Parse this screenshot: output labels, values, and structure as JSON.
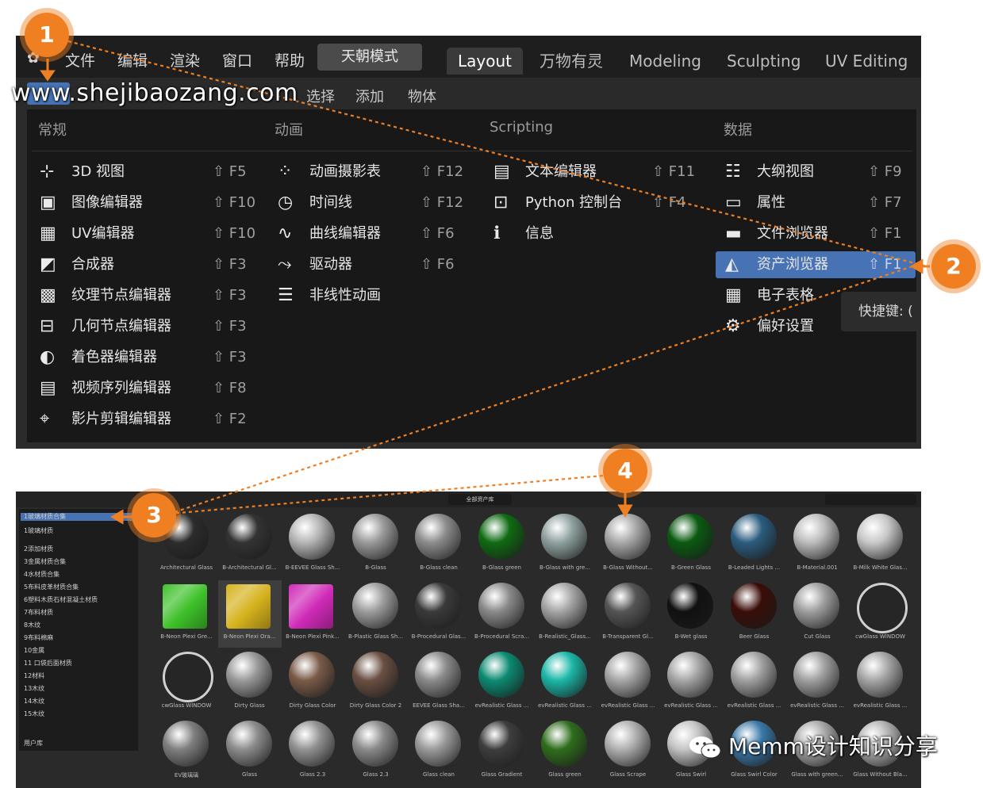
{
  "topbar": {
    "menu": [
      "文件",
      "编辑",
      "渲染",
      "窗口",
      "帮助"
    ],
    "mode_button": "天朝模式",
    "workspace_tabs": [
      "Layout",
      "万物有灵",
      "Modeling",
      "Sculpting",
      "UV Editing"
    ]
  },
  "subheader": {
    "items": [
      "选择",
      "添加",
      "物体"
    ]
  },
  "editor_menu": {
    "columns": [
      "常规",
      "动画",
      "Scripting",
      "数据"
    ],
    "general": [
      {
        "label": "3D 视图",
        "key": "⇧ F5",
        "icon": "3d-view-icon"
      },
      {
        "label": "图像编辑器",
        "key": "⇧ F10",
        "icon": "image-editor-icon"
      },
      {
        "label": "UV编辑器",
        "key": "⇧ F10",
        "icon": "uv-editor-icon"
      },
      {
        "label": "合成器",
        "key": "⇧ F3",
        "icon": "compositor-icon"
      },
      {
        "label": "纹理节点编辑器",
        "key": "⇧ F3",
        "icon": "texture-node-icon"
      },
      {
        "label": "几何节点编辑器",
        "key": "⇧ F3",
        "icon": "geometry-node-icon"
      },
      {
        "label": "着色器编辑器",
        "key": "⇧ F3",
        "icon": "shader-editor-icon"
      },
      {
        "label": "视频序列编辑器",
        "key": "⇧ F8",
        "icon": "video-sequencer-icon"
      },
      {
        "label": "影片剪辑编辑器",
        "key": "⇧ F2",
        "icon": "movie-clip-icon"
      }
    ],
    "animation": [
      {
        "label": "动画摄影表",
        "key": "⇧ F12",
        "icon": "dopesheet-icon"
      },
      {
        "label": "时间线",
        "key": "⇧ F12",
        "icon": "timeline-icon"
      },
      {
        "label": "曲线编辑器",
        "key": "⇧ F6",
        "icon": "graph-editor-icon"
      },
      {
        "label": "驱动器",
        "key": "⇧ F6",
        "icon": "drivers-icon"
      },
      {
        "label": "非线性动画",
        "key": "",
        "icon": "nla-icon"
      }
    ],
    "scripting": [
      {
        "label": "文本编辑器",
        "key": "⇧ F11",
        "icon": "text-editor-icon"
      },
      {
        "label": "Python 控制台",
        "key": "⇧ F4",
        "icon": "python-console-icon"
      },
      {
        "label": "信息",
        "key": "",
        "icon": "info-icon"
      }
    ],
    "data": [
      {
        "label": "大纲视图",
        "key": "⇧ F9",
        "icon": "outliner-icon"
      },
      {
        "label": "属性",
        "key": "⇧ F7",
        "icon": "properties-icon"
      },
      {
        "label": "文件浏览器",
        "key": "⇧ F1",
        "icon": "file-browser-icon"
      },
      {
        "label": "资产浏览器",
        "key": "⇧ F1",
        "icon": "asset-browser-icon"
      },
      {
        "label": "电子表格",
        "key": "",
        "icon": "spreadsheet-icon"
      },
      {
        "label": "偏好设置",
        "key": "",
        "icon": "preferences-icon"
      }
    ],
    "tooltip": "快捷键: ("
  },
  "watermark_top": "www.shejibaozang.com",
  "badges": [
    "1",
    "2",
    "3",
    "4"
  ],
  "asset_browser": {
    "side_items": [
      "1玻璃材质合集",
      "1玻璃材质",
      "2添加材质",
      "3金属材质合集",
      "4水材质合集",
      "5布料皮革材质合集",
      "6塑料木质石材混凝土材质",
      "7布料材质",
      "8木纹",
      "9布料棉麻",
      "10金属",
      "11 口袋后面材质",
      "12材料",
      "13木纹",
      "14木纹",
      "15木纹",
      "用户库"
    ],
    "filter": "全部资产库",
    "items": [
      {
        "name": "Architectural Glass",
        "color": "#2c2c2c"
      },
      {
        "name": "B-Architectural Gl...",
        "color": "#333333"
      },
      {
        "name": "B-EEVEE Glass Sh...",
        "color": "#b5b5b5"
      },
      {
        "name": "B-Glass",
        "color": "#9a9a9a"
      },
      {
        "name": "B-Glass clean",
        "color": "#8c8c8c"
      },
      {
        "name": "B-Glass green",
        "color": "#0f6b12"
      },
      {
        "name": "B-Glass with gre...",
        "color": "#8fa2a0"
      },
      {
        "name": "B-Glass Without...",
        "color": "#a8a8a8"
      },
      {
        "name": "B-Green Glass",
        "color": "#0a5a10"
      },
      {
        "name": "B-Leaded Lights ...",
        "color": "#2b5c7e"
      },
      {
        "name": "B-Material.001",
        "color": "#bcbcbc"
      },
      {
        "name": "B-Milk White Glas...",
        "color": "#c8c8c8"
      },
      {
        "name": "B-Neon Plexi Gre...",
        "color": "#3fc12a"
      },
      {
        "name": "B-Neon Plexi Ora...",
        "color": "#d6b21d"
      },
      {
        "name": "B-Neon Plexi Pink...",
        "color": "#d02ab8"
      },
      {
        "name": "B-Plastic Glass Sh...",
        "color": "#9d9d9d"
      },
      {
        "name": "B-Procedural Glas...",
        "color": "#3a3a3a"
      },
      {
        "name": "B-Procedural Scra...",
        "color": "#8a8a8a"
      },
      {
        "name": "B-Realistic_Glass...",
        "color": "#a5a5a5"
      },
      {
        "name": "B-Transparent Gl...",
        "color": "#555555"
      },
      {
        "name": "B-Wet glass",
        "color": "#111111"
      },
      {
        "name": "Beer Glass",
        "color": "#3a0d08"
      },
      {
        "name": "Cut Glass",
        "color": "#9e9e9e"
      },
      {
        "name": "cwGlass WINDOW",
        "color": "#2a2a2a"
      },
      {
        "name": "cwGlass WINDOW",
        "color": "#2a2a2a"
      },
      {
        "name": "Dirty Glass",
        "color": "#9a9a9a"
      },
      {
        "name": "Dirty Glass Color",
        "color": "#7a5a48"
      },
      {
        "name": "Dirty Glass Color 2",
        "color": "#6a4f42"
      },
      {
        "name": "EEVEE Glass Sha...",
        "color": "#8a8a8a"
      },
      {
        "name": "evRealistic Glass ...",
        "color": "#0c8a72"
      },
      {
        "name": "evRealistic Glass ...",
        "color": "#1bb7a8"
      },
      {
        "name": "evRealistic Glass ...",
        "color": "#a6a6a6"
      },
      {
        "name": "evRealistic Glass ...",
        "color": "#a6a6a6"
      },
      {
        "name": "evRealistic Glass ...",
        "color": "#a0a0a0"
      },
      {
        "name": "evRealistic Glass ...",
        "color": "#a0a0a0"
      },
      {
        "name": "evRealistic Glass ...",
        "color": "#a6a6a6"
      },
      {
        "name": "EV玻璃璃",
        "color": "#7f7f7f"
      },
      {
        "name": "Glass",
        "color": "#8c8c8c"
      },
      {
        "name": "Glass 2.3",
        "color": "#929292"
      },
      {
        "name": "Glass 2.3",
        "color": "#8a8a8a"
      },
      {
        "name": "Glass clean",
        "color": "#9a9a9a"
      },
      {
        "name": "Glass Gradient",
        "color": "#3d3d3d"
      },
      {
        "name": "Glass green",
        "color": "#2e6e1c"
      },
      {
        "name": "Glass Scrape",
        "color": "#b0b0b0"
      },
      {
        "name": "Glass Swirl",
        "color": "#c4c4c4"
      },
      {
        "name": "Glass Swirl Color",
        "color": "#3a78a8"
      },
      {
        "name": "Glass with green...",
        "color": "#a9a9a9"
      },
      {
        "name": "Glass Without Bla...",
        "color": "#b2b2b2"
      }
    ]
  },
  "watermark_bottom": "Memm设计知识分享",
  "colors": {
    "accent": "#4772b3",
    "badge": "#f07f22",
    "panel": "#181818"
  }
}
